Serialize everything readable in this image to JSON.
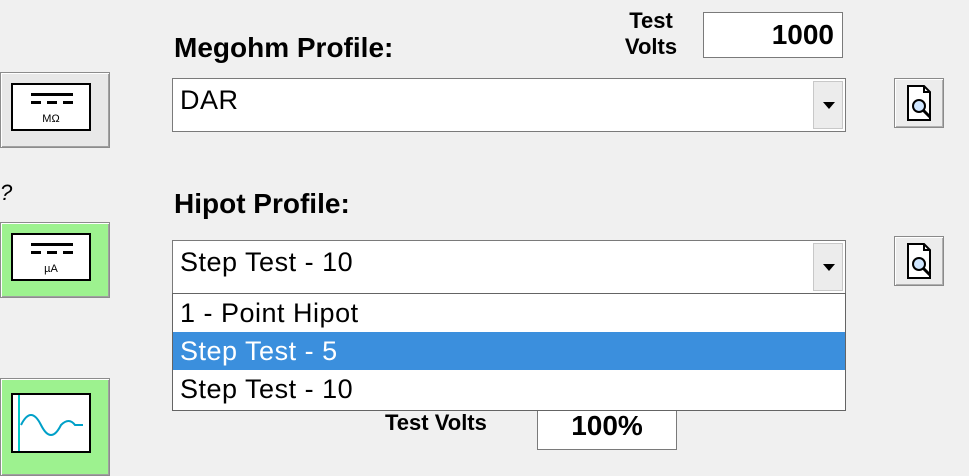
{
  "megohm": {
    "label": "Megohm Profile:",
    "selected": "DAR",
    "test_volts_label_line1": "Test",
    "test_volts_label_line2": "Volts",
    "test_volts_value": "1000"
  },
  "hipot": {
    "label": "Hipot Profile:",
    "selected": "Step Test - 10",
    "options": [
      "1 - Point Hipot",
      "Step Test - 5",
      "Step Test - 10"
    ],
    "highlighted_index": 1
  },
  "partial_test_volts": {
    "label": "Test Volts",
    "value": "100%"
  },
  "mode_buttons": {
    "megohm_unit": "MΩ",
    "hipot_unit": "µA"
  },
  "colors": {
    "active_green": "#9df28f",
    "selection_blue": "#3b8fdd"
  }
}
